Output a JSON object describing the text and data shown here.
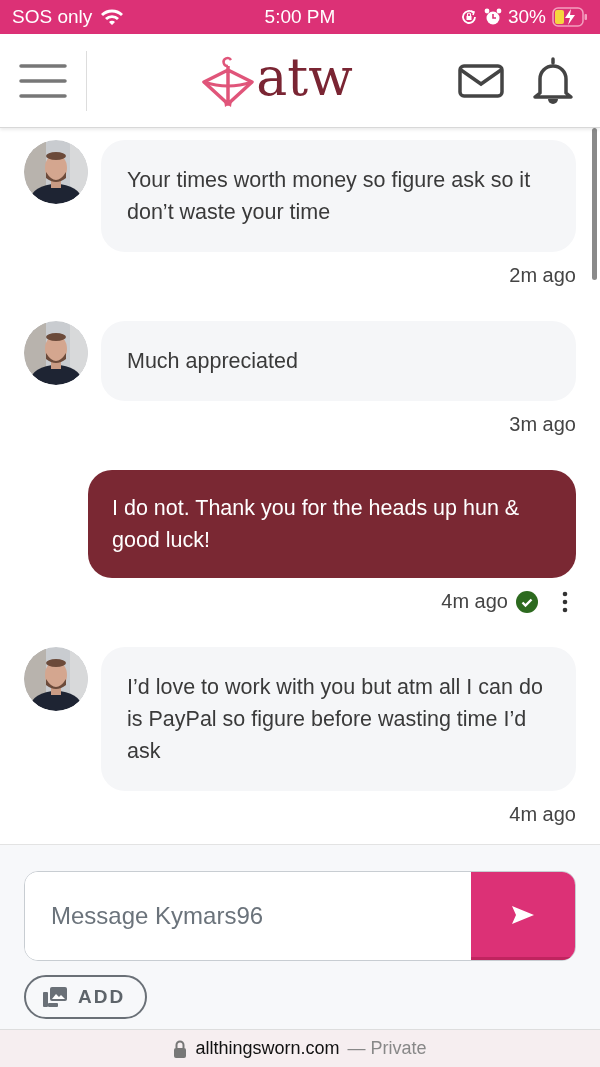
{
  "status_bar": {
    "carrier": "SOS only",
    "time": "5:00 PM",
    "battery": "30%"
  },
  "header": {
    "logo": "atw"
  },
  "messages": [
    {
      "kind": "incoming",
      "text": "Your times worth money so figure ask so it don’t waste your time",
      "time": "2m ago"
    },
    {
      "kind": "incoming",
      "text": "Much appreciated",
      "time": "3m ago"
    },
    {
      "kind": "outgoing",
      "text": "I do not. Thank you for the heads up hun & good luck!",
      "time": "4m ago",
      "read": true
    },
    {
      "kind": "incoming",
      "text": "I’d love to work with you but atm all I can do is PayPal so figure before wasting time I’d ask",
      "time": "4m ago"
    }
  ],
  "composer": {
    "placeholder": "Message Kymars96",
    "add_label": "ADD"
  },
  "browser_bar": {
    "domain": "allthingsworn.com",
    "suffix": "— Private"
  }
}
